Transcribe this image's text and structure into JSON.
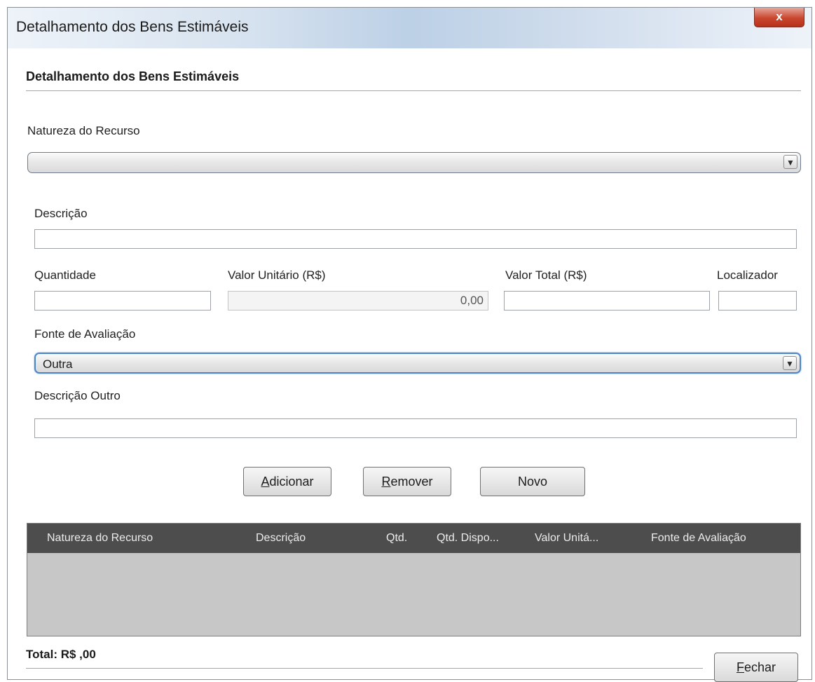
{
  "window": {
    "title": "Detalhamento dos Bens Estimáveis",
    "close_symbol": "x"
  },
  "form": {
    "section_title": "Detalhamento dos Bens Estimáveis",
    "natureza": {
      "label": "Natureza do Recurso",
      "value": ""
    },
    "descricao": {
      "label": "Descrição",
      "value": ""
    },
    "quantidade": {
      "label": "Quantidade",
      "value": ""
    },
    "valor_unitario": {
      "label": "Valor Unitário (R$)",
      "value": "0,00"
    },
    "valor_total": {
      "label": "Valor Total (R$)",
      "value": ""
    },
    "localizador": {
      "label": "Localizador",
      "value": ""
    },
    "fonte": {
      "label": "Fonte de Avaliação",
      "value": "Outra"
    },
    "descricao_outro": {
      "label": "Descrição Outro",
      "value": ""
    },
    "dropdown_arrow": "▼"
  },
  "buttons": {
    "adicionar": {
      "mnemonic": "A",
      "rest": "dicionar"
    },
    "remover": {
      "mnemonic": "R",
      "rest": "emover"
    },
    "novo": "Novo",
    "fechar": {
      "mnemonic": "F",
      "rest": "echar"
    }
  },
  "table": {
    "columns": [
      "Natureza do Recurso",
      "Descrição",
      "Qtd.",
      "Qtd. Dispo...",
      "Valor Unitá...",
      "Fonte de Avaliação"
    ],
    "rows": []
  },
  "footer": {
    "total": "Total: R$  ,00"
  }
}
